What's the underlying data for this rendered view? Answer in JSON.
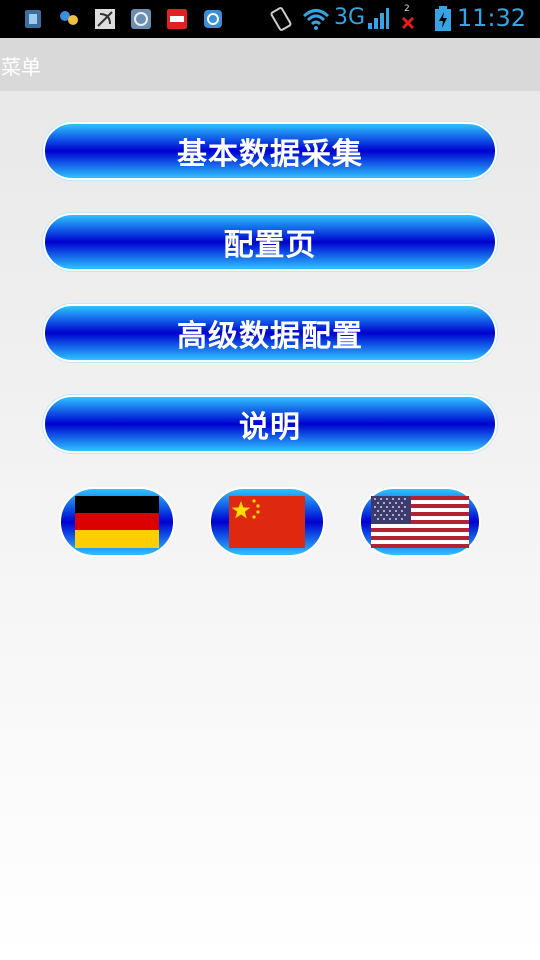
{
  "status_bar": {
    "time": "11:32",
    "network": "3G",
    "sim_badge": "2",
    "notification_icons": [
      "sim-card-icon",
      "handshake-icon",
      "satellite-dish-icon",
      "app-circle-icon",
      "news-icon",
      "qq-icon"
    ],
    "system_icons": [
      "vibrate-icon",
      "wifi-icon",
      "signal-icon",
      "no-signal-icon",
      "battery-charging-icon"
    ]
  },
  "title_bar": {
    "title": "菜单"
  },
  "menu": {
    "buttons": [
      {
        "label": "基本数据采集"
      },
      {
        "label": "配置页"
      },
      {
        "label": "高级数据配置"
      },
      {
        "label": "说明"
      }
    ]
  },
  "languages": [
    {
      "icon": "germany-flag-icon"
    },
    {
      "icon": "china-flag-icon"
    },
    {
      "icon": "usa-flag-icon"
    }
  ],
  "colors": {
    "button_dark": "#0000cf",
    "button_light": "#2fc3ff",
    "status_accent": "#36a4e4"
  }
}
